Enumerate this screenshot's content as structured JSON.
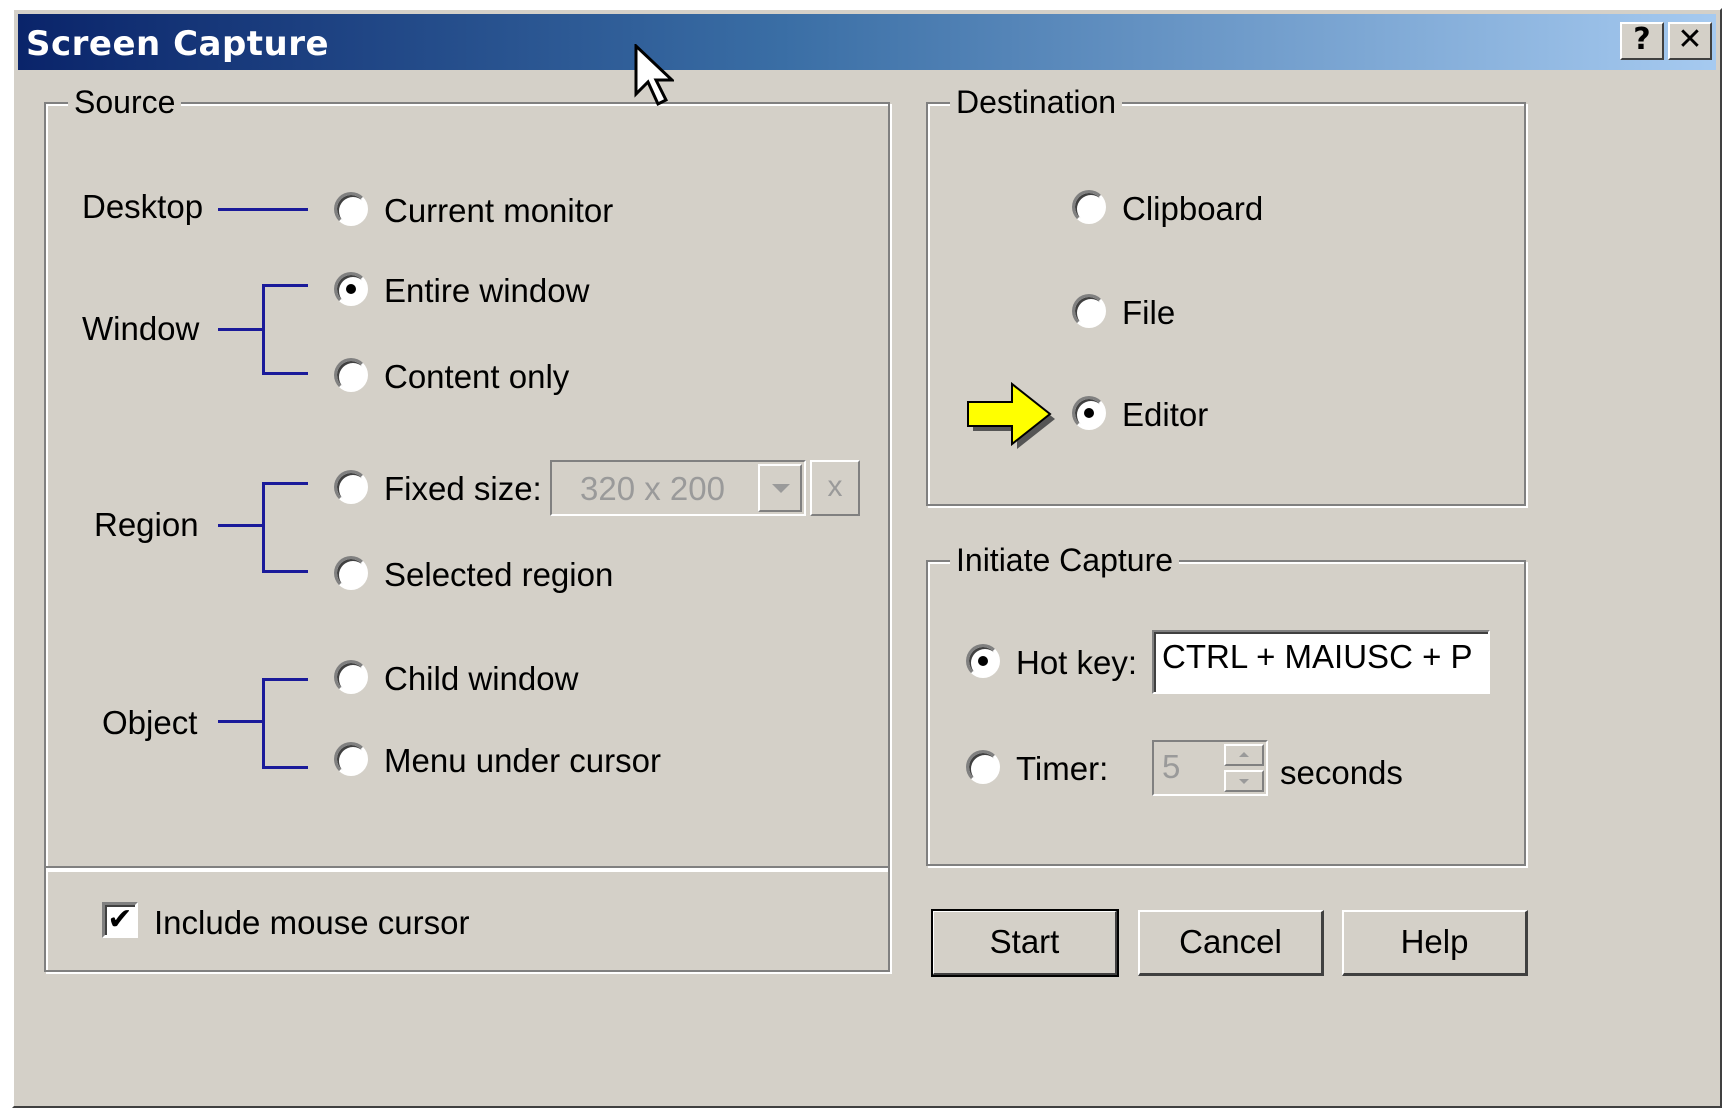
{
  "window": {
    "title": "Screen Capture",
    "help_label": "?",
    "close_label": "✕"
  },
  "source": {
    "legend": "Source",
    "categories": {
      "desktop": "Desktop",
      "window": "Window",
      "region": "Region",
      "object": "Object"
    },
    "options": {
      "current_monitor": "Current monitor",
      "entire_window": "Entire window",
      "content_only": "Content only",
      "fixed_size": "Fixed size:",
      "selected_region": "Selected region",
      "child_window": "Child window",
      "menu_under_cursor": "Menu under cursor"
    },
    "selected": "entire_window",
    "fixed_size_value": "320 x 200",
    "fixed_size_button": "x"
  },
  "include_cursor": {
    "label": "Include mouse cursor",
    "checked": true,
    "check_mark": "✔"
  },
  "destination": {
    "legend": "Destination",
    "options": {
      "clipboard": "Clipboard",
      "file": "File",
      "editor": "Editor"
    },
    "selected": "editor"
  },
  "initiate": {
    "legend": "Initiate Capture",
    "hotkey_label": "Hot key:",
    "hotkey_value": "CTRL + MAIUSC + P",
    "timer_label": "Timer:",
    "timer_value": "5",
    "seconds_label": "seconds",
    "selected": "hotkey"
  },
  "buttons": {
    "start": "Start",
    "cancel": "Cancel",
    "help": "Help"
  },
  "icons": {
    "arrow": "yellow-arrow-icon",
    "cursor": "mouse-pointer-icon"
  },
  "colors": {
    "title_start": "#0a246a",
    "title_end": "#a6caf0",
    "face": "#d4d0c8",
    "tree_line": "#1a1a9a",
    "arrow_fill": "#ffff00"
  }
}
